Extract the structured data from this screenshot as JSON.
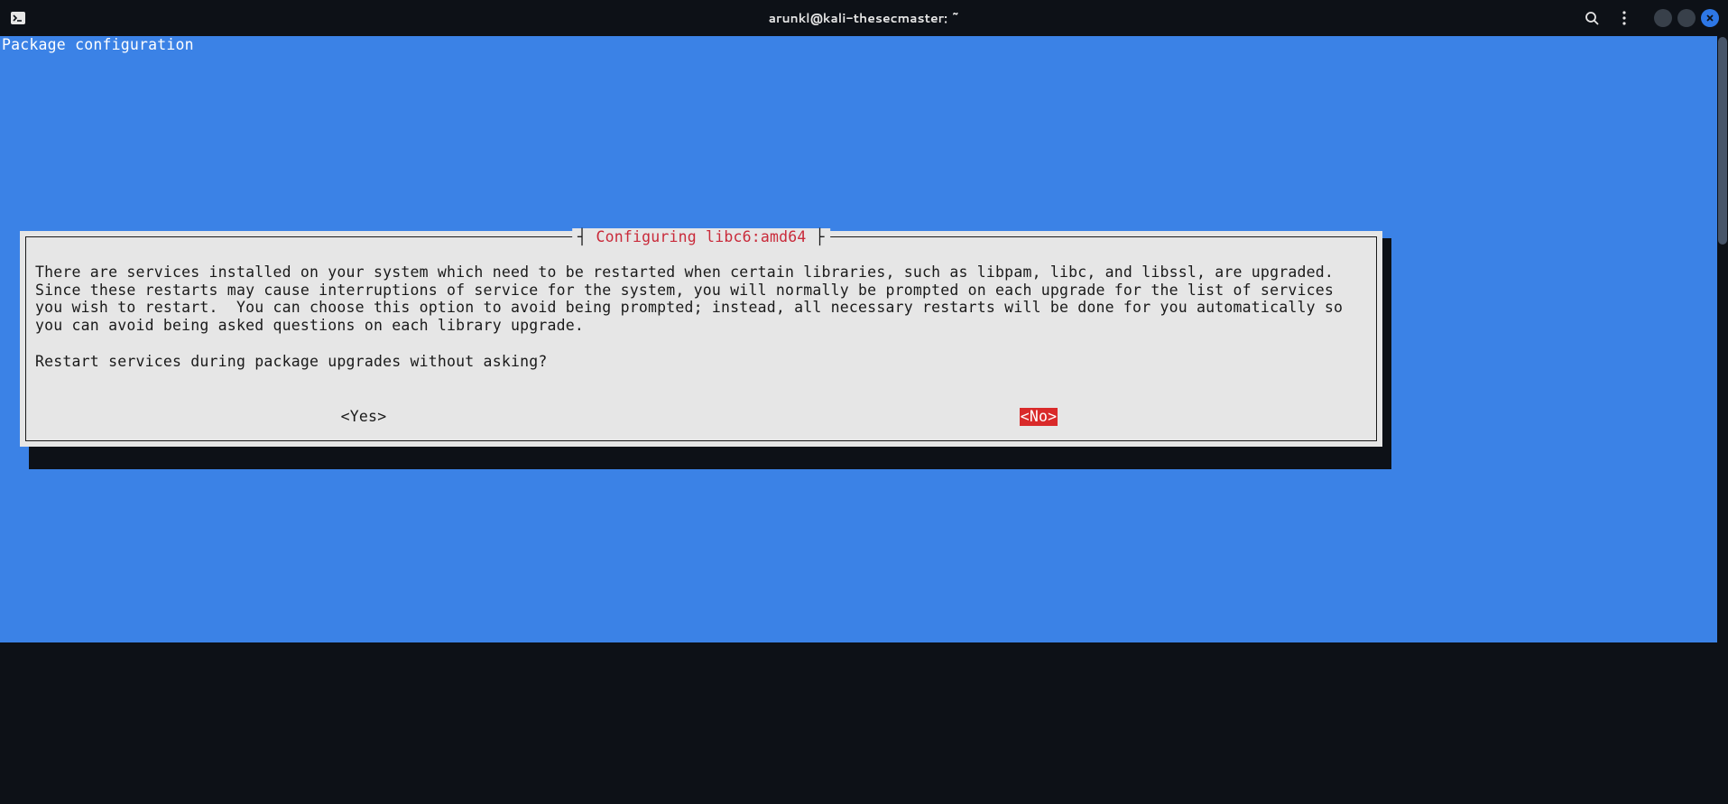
{
  "titlebar": {
    "title": "arunkl@kali-thesecmaster: ~"
  },
  "terminal": {
    "header": "Package configuration"
  },
  "dialog": {
    "title": "Configuring libc6:amd64",
    "body_para": "There are services installed on your system which need to be restarted when certain libraries, such as libpam, libc, and libssl, are upgraded. Since these restarts may cause interruptions of service for the system, you will normally be prompted on each upgrade for the list of services you wish to restart.  You can choose this option to avoid being prompted; instead, all necessary restarts will be done for you automatically so you can avoid being asked questions on each library upgrade.",
    "question": "Restart services during package upgrades without asking?",
    "yes_label": "<Yes>",
    "no_label": "<No>"
  }
}
